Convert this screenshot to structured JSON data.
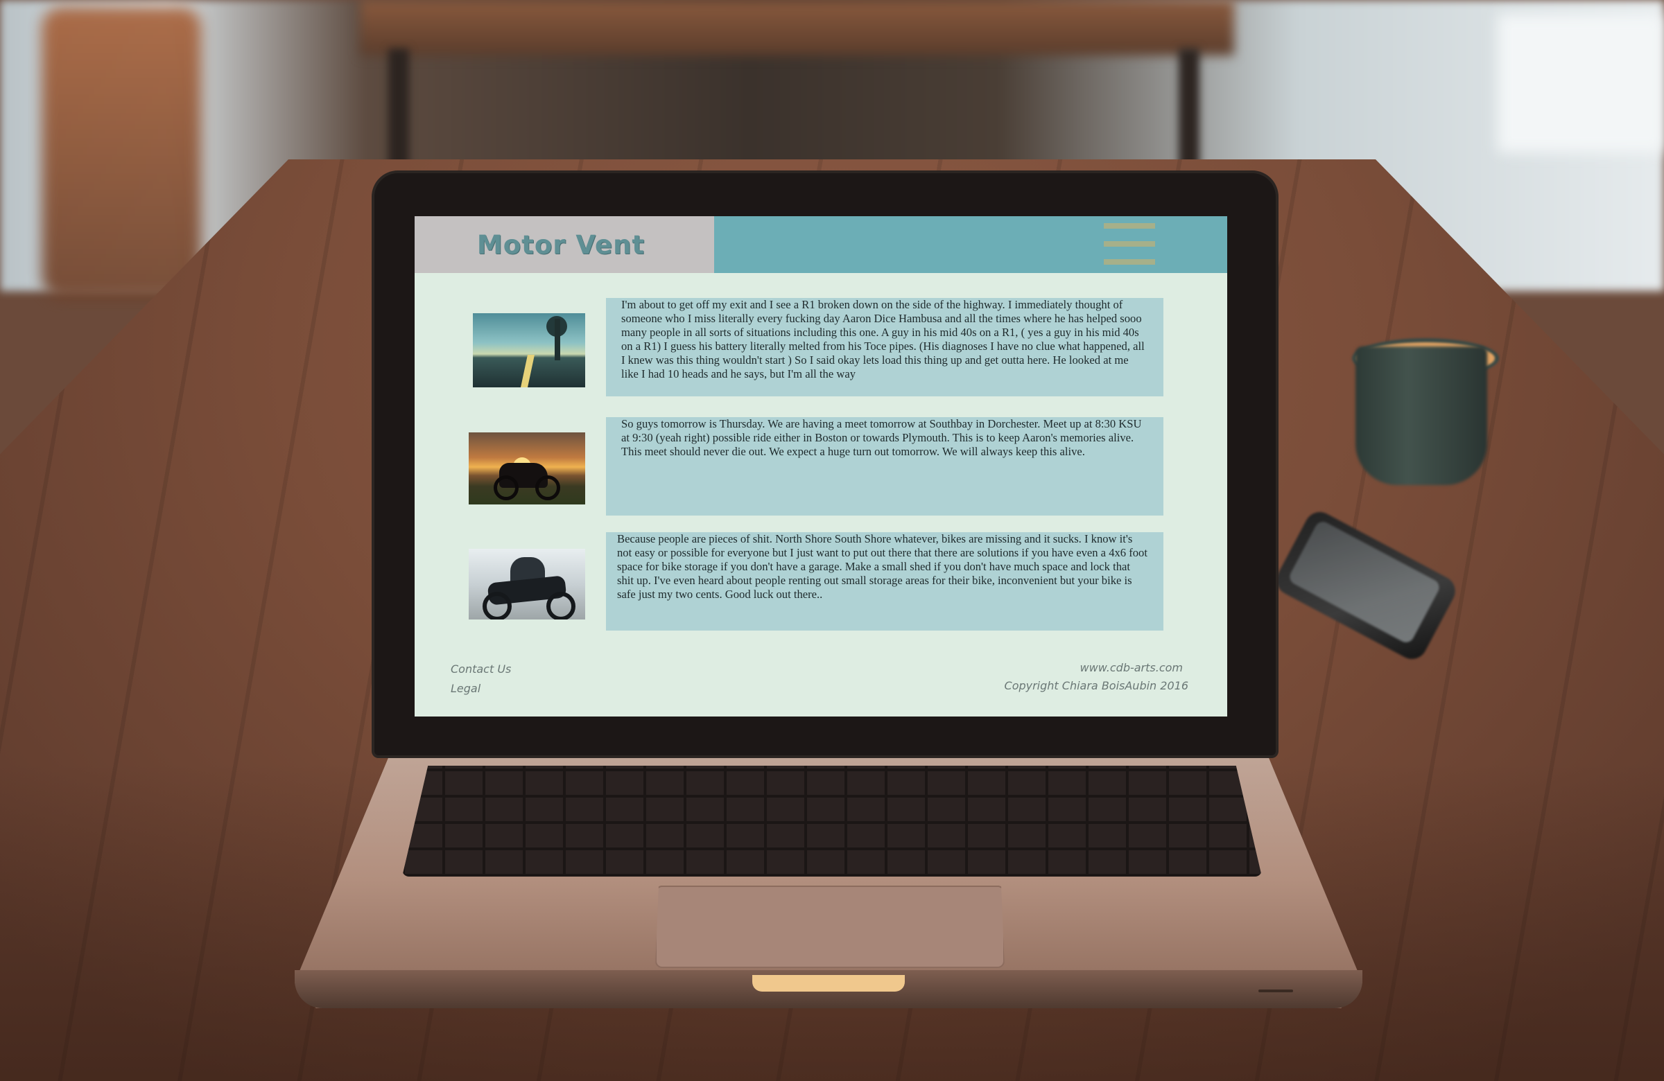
{
  "site": {
    "logo": "Motor Vent"
  },
  "posts": [
    {
      "text": "I'm about to get off my exit and I see a R1 broken down on the side of the highway. I immediately thought of someone who I miss literally every fucking day Aaron Dice Hambusa and all the times where he has helped sooo many people in all sorts of situations including this one. A guy in his mid 40s on a R1, ( yes a guy in his mid 40s on a R1) I guess his battery literally melted from his Toce pipes. (His diagnoses I have no clue what happened, all I knew was this thing wouldn't start ) So I said okay lets load this thing up and get outta here. He looked at me like I had 10 heads and he says, but I'm all the way",
      "image": "road-tree-photo"
    },
    {
      "text": "So guys tomorrow is Thursday. We are having a meet tomorrow at Southbay in Dorchester. Meet up at 8:30 KSU at 9:30 (yeah right) possible ride either in Boston or towards Plymouth. This is to keep Aaron's memories alive. This meet should never die out. We expect a huge turn out tomorrow. We will always keep this alive.",
      "image": "sunset-motorcycle-photo"
    },
    {
      "text": "Because people are pieces of shit. North Shore South Shore whatever, bikes are missing and it sucks. I know it's not easy or possible for everyone but I just want to put out there that there are solutions if you have even a 4x6 foot space for bike storage if you don't have a garage. Make a small shed if you don't have much space and lock that shit up. I've even heard about people renting out small storage areas for their bike, inconvenient but your bike is safe just my two cents. Good luck out there..",
      "image": "rider-motorcycle-photo"
    }
  ],
  "footer": {
    "contact": "Contact Us",
    "legal": "Legal",
    "website": "www.cdb-arts.com",
    "copyright": "Copyright Chiara BoisAubin 2016"
  },
  "colors": {
    "page_bg": "#deede2",
    "logo_box": "#c4c1c1",
    "nav_bar": "#6caeb6",
    "post_box": "#afd2d4",
    "menu_lines": "#a6b08a",
    "logo_text": "#5f8f94"
  }
}
